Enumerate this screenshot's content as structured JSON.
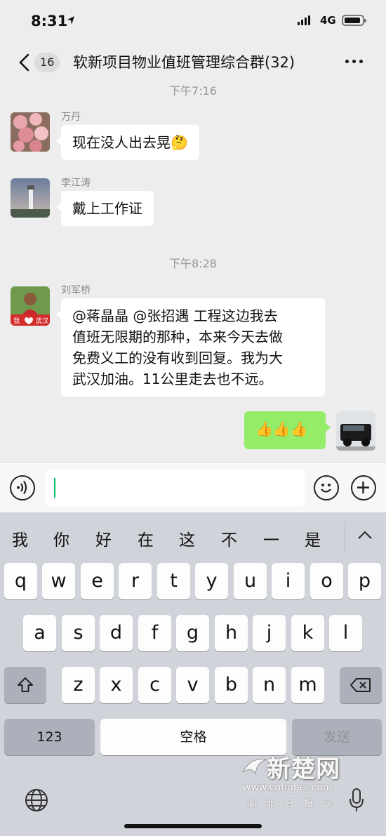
{
  "status_bar": {
    "time": "8:31",
    "network": "4G"
  },
  "header": {
    "unread_count": "16",
    "title": "软新项目物业值班管理综合群(32)"
  },
  "chat": {
    "timestamps": [
      "下午7:16",
      "下午8:28"
    ],
    "messages": [
      {
        "sender": "万丹",
        "text": "现在没人出去晃🤔"
      },
      {
        "sender": "李江涛",
        "text": "戴上工作证"
      },
      {
        "sender": "刘军桥",
        "lines": [
          "@蒋晶晶 @张招遇 工程这边我去",
          "值班无限期的那种，本来今天去做",
          "免费义工的没有收到回复。我为大",
          "武汉加油。11公里走去也不远。"
        ]
      },
      {
        "sender": "",
        "text": "👍👍👍",
        "mine": true
      }
    ]
  },
  "input": {
    "value": ""
  },
  "keyboard": {
    "candidates": [
      "我",
      "你",
      "好",
      "在",
      "这",
      "不",
      "一",
      "是"
    ],
    "rows": [
      [
        "q",
        "w",
        "e",
        "r",
        "t",
        "y",
        "u",
        "i",
        "o",
        "p"
      ],
      [
        "a",
        "s",
        "d",
        "f",
        "g",
        "h",
        "j",
        "k",
        "l"
      ],
      [
        "z",
        "x",
        "c",
        "v",
        "b",
        "n",
        "m"
      ]
    ],
    "numbers_key": "123",
    "space_key": "空格",
    "send_key": "发送"
  },
  "watermark": {
    "brand": "新楚网",
    "url": "www.cnhubei.com",
    "tag": "湖北日报网"
  },
  "colors": {
    "self_bubble": "#95ec69",
    "other_bubble": "#ffffff",
    "background": "#ededed",
    "caret": "#07c160"
  }
}
